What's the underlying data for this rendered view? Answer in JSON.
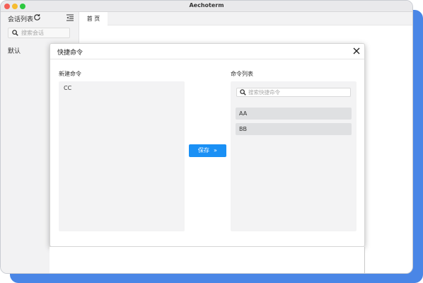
{
  "window": {
    "title": "Aechoterm"
  },
  "sidebar": {
    "title": "会话列表",
    "search_placeholder": "搜索会话",
    "default_group": "默认"
  },
  "tabs": [
    {
      "label": "首 页"
    }
  ],
  "modal": {
    "title": "快捷命令",
    "new_label": "新建命令",
    "editor_value": "CC",
    "save_label": "保存",
    "save_arrow": "»",
    "list_label": "命令列表",
    "list_search_placeholder": "搜索快捷命令",
    "commands": [
      {
        "label": "AA"
      },
      {
        "label": "BB"
      }
    ]
  },
  "colors": {
    "accent": "#1a90f5",
    "backdrop": "#4a86e6",
    "panel": "#f3f3f4",
    "item": "#dfe0e2"
  },
  "icons": {
    "refresh": "refresh-icon",
    "collapse": "collapse-sidebar-icon",
    "search": "search-icon",
    "close": "close-icon",
    "double_arrow": "double-chevron-right-icon"
  }
}
